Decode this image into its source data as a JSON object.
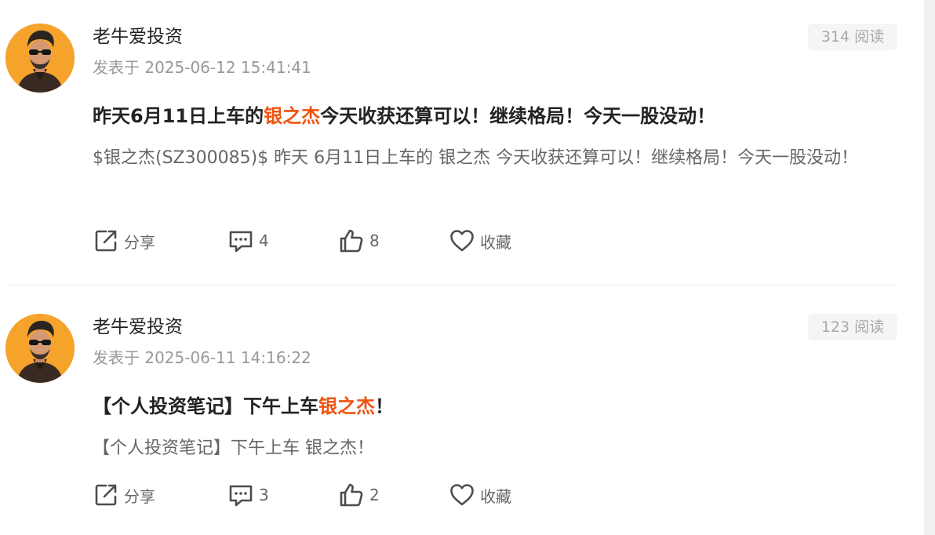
{
  "posts": [
    {
      "author": "老牛爱投资",
      "meta": "发表于 2025-06-12 15:41:41",
      "reads": "314 阅读",
      "title_before": "昨天6月11日上车的",
      "title_highlight": "银之杰",
      "title_after": "今天收获还算可以！继续格局！今天一股没动！",
      "excerpt": "$银之杰(SZ300085)$ 昨天 6月11日上车的 银之杰 今天收获还算可以！继续格局！今天一股没动！",
      "actions": {
        "share": "分享",
        "comments": "4",
        "likes": "8",
        "favorite": "收藏"
      }
    },
    {
      "author": "老牛爱投资",
      "meta": "发表于 2025-06-11 14:16:22",
      "reads": "123 阅读",
      "title_before": "【个人投资笔记】下午上车",
      "title_highlight": "银之杰",
      "title_after": "！",
      "excerpt": "【个人投资笔记】下午上车 银之杰！",
      "actions": {
        "share": "分享",
        "comments": "3",
        "likes": "2",
        "favorite": "收藏"
      }
    }
  ],
  "colors": {
    "highlight": "#f0530f",
    "avatar_bg": "#f6a32b",
    "meta_text": "#999999",
    "badge_bg": "#f5f5f7"
  },
  "icons": [
    "avatar",
    "share-icon",
    "comment-icon",
    "like-icon",
    "favorite-icon"
  ]
}
